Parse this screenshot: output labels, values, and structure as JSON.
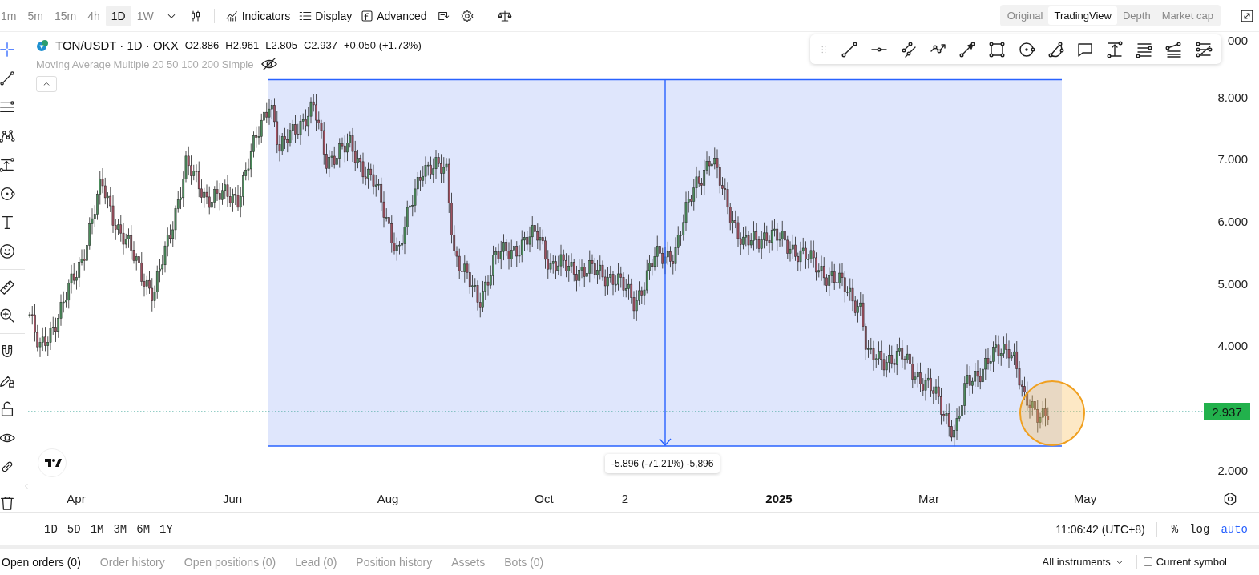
{
  "toolbar": {
    "intervals": [
      {
        "label": "1m",
        "selected": false
      },
      {
        "label": "5m",
        "selected": false
      },
      {
        "label": "15m",
        "selected": false
      },
      {
        "label": "4h",
        "selected": false
      },
      {
        "label": "1D",
        "selected": true
      },
      {
        "label": "1W",
        "selected": false
      }
    ],
    "buttons": [
      {
        "label": "Indicators"
      },
      {
        "label": "Display"
      },
      {
        "label": "Advanced"
      }
    ]
  },
  "view_modes": [
    {
      "label": "Original",
      "selected": false
    },
    {
      "label": "TradingView",
      "selected": true
    },
    {
      "label": "Depth",
      "selected": false
    },
    {
      "label": "Market cap",
      "selected": false
    }
  ],
  "legend": {
    "symbol": "TON/USDT · 1D · OKX",
    "values": [
      "O2.886",
      "H2.961",
      "L2.805",
      "C2.937",
      "+0.050 (+1.73%)"
    ],
    "indicator": "Moving Average Multiple 20 50 100 200 Simple"
  },
  "measure_label": "-5.896 (-71.21%) -5,896",
  "price_axis": {
    "ticks": [
      "000",
      "8.000",
      "7.000",
      "6.000",
      "5.000",
      "4.000",
      "2.000"
    ],
    "current_price": "2.937"
  },
  "time_axis": [
    {
      "label": "Apr",
      "kind": "month"
    },
    {
      "label": "Jun",
      "kind": "month"
    },
    {
      "label": "Aug",
      "kind": "month"
    },
    {
      "label": "Oct",
      "kind": "month"
    },
    {
      "label": "2",
      "kind": "month"
    },
    {
      "label": "2025",
      "kind": "year"
    },
    {
      "label": "Mar",
      "kind": "month"
    },
    {
      "label": "May",
      "kind": "month"
    }
  ],
  "ranges": [
    "1D",
    "5D",
    "1M",
    "3M",
    "6M",
    "1Y"
  ],
  "status": {
    "time": "11:06:42 (UTC+8)",
    "toggles": [
      {
        "label": "%",
        "selected": false
      },
      {
        "label": "log",
        "selected": false
      },
      {
        "label": "auto",
        "selected": true
      }
    ]
  },
  "order_tabs": [
    {
      "label": "Open orders (0)",
      "selected": true
    },
    {
      "label": "Order history",
      "selected": false
    },
    {
      "label": "Open positions (0)",
      "selected": false
    },
    {
      "label": "Lead (0)",
      "selected": false
    },
    {
      "label": "Position history",
      "selected": false
    },
    {
      "label": "Assets",
      "selected": false
    },
    {
      "label": "Bots (0)",
      "selected": false
    }
  ],
  "filter": "All instruments",
  "current_symbol": {
    "label": "Current symbol",
    "checked": false
  }
}
